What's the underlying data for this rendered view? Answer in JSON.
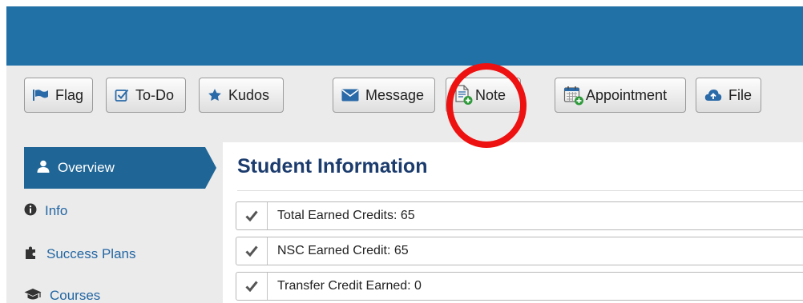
{
  "toolbar": {
    "flag_label": "Flag",
    "todo_label": "To-Do",
    "kudos_label": "Kudos",
    "message_label": "Message",
    "note_label": "Note",
    "appointment_label": "Appointment",
    "file_label": "File"
  },
  "sidebar": {
    "items": [
      {
        "label": "Overview",
        "icon": "user-icon",
        "active": true
      },
      {
        "label": "Info",
        "icon": "info-icon"
      },
      {
        "label": "Success Plans",
        "icon": "puzzle-icon"
      },
      {
        "label": "Courses",
        "icon": "graduation-cap-icon"
      }
    ]
  },
  "main": {
    "title": "Student Information",
    "rows": [
      "Total Earned Credits: 65",
      "NSC Earned Credit: 65",
      "Transfer Credit Earned: 0"
    ]
  },
  "colors": {
    "header": "#2271a6",
    "active_nav": "#1f6596",
    "link": "#2366a3",
    "title": "#1c3c6e",
    "highlight_circle": "#ee1111"
  }
}
